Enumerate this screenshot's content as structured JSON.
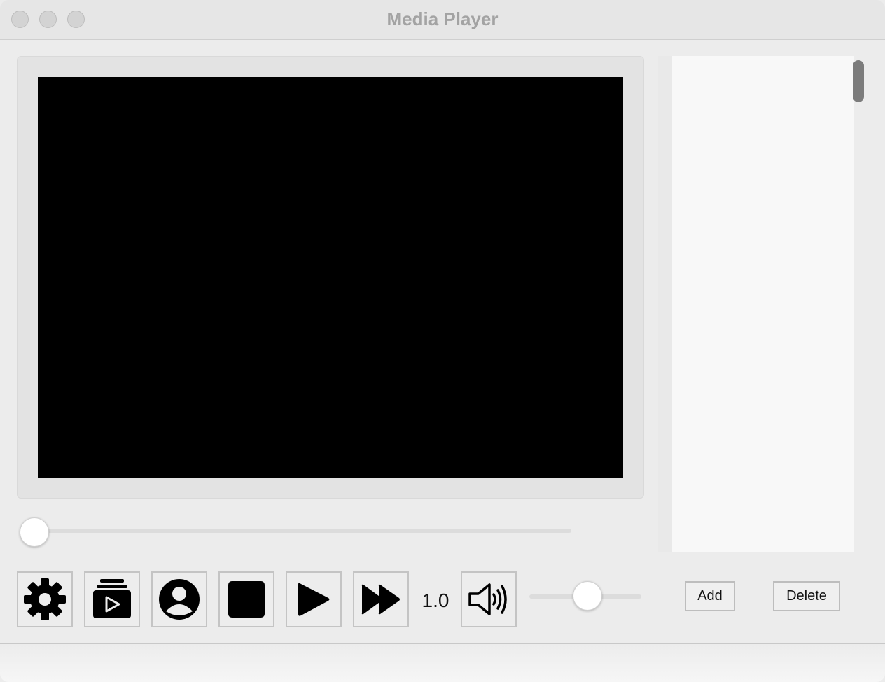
{
  "window": {
    "title": "Media Player"
  },
  "player": {
    "progress": 0.0,
    "speed_label": "1.0",
    "volume": 0.5
  },
  "controls": {
    "settings_icon": "gear-icon",
    "playlist_icon": "playlist-video-icon",
    "profile_icon": "user-circle-icon",
    "stop_icon": "stop-icon",
    "play_icon": "play-icon",
    "fast_forward_icon": "fast-forward-icon",
    "volume_icon": "speaker-volume-icon"
  },
  "playlist": {
    "items": [],
    "add_label": "Add",
    "delete_label": "Delete"
  },
  "colors": {
    "video_background": "#000000",
    "window_background": "#ececec",
    "title_text": "#a3a3a3"
  }
}
